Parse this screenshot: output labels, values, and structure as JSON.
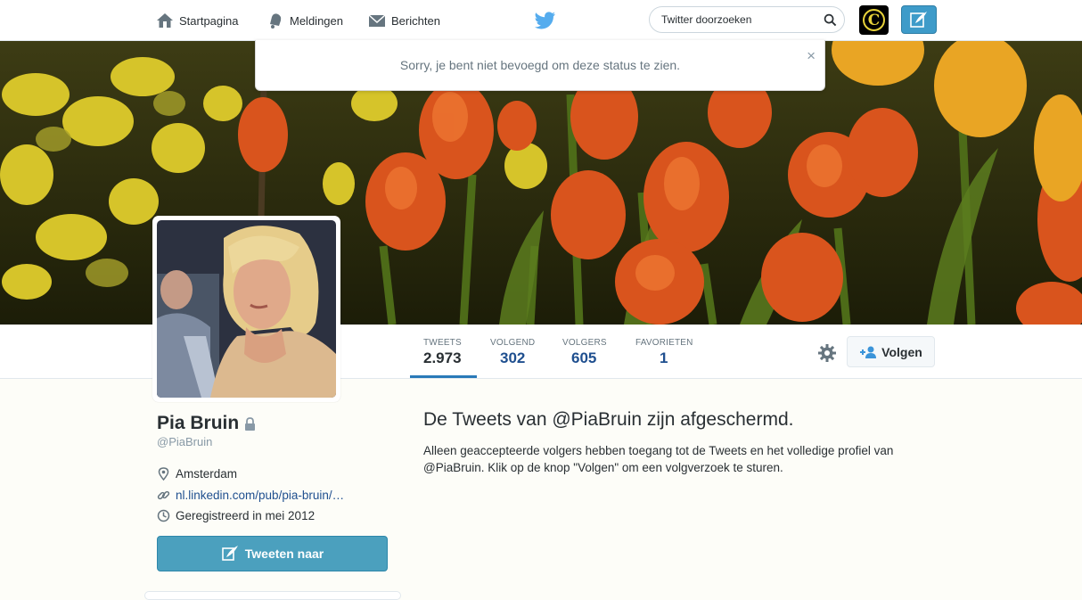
{
  "topbar": {
    "home_label": "Startpagina",
    "notifications_label": "Meldingen",
    "messages_label": "Berichten",
    "search_placeholder": "Twitter doorzoeken",
    "user_avatar_letter": "C"
  },
  "alert": {
    "message": "Sorry, je bent niet bevoegd om deze status te zien.",
    "close_symbol": "×"
  },
  "stats": [
    {
      "label": "TWEETS",
      "value": "2.973"
    },
    {
      "label": "VOLGEND",
      "value": "302"
    },
    {
      "label": "VOLGERS",
      "value": "605"
    },
    {
      "label": "FAVORIETEN",
      "value": "1"
    }
  ],
  "follow_button": "Volgen",
  "profile": {
    "name": "Pia Bruin",
    "handle": "@PiaBruin",
    "location": "Amsterdam",
    "url": "nl.linkedin.com/pub/pia-bruin/…",
    "joined": "Geregistreerd in mei 2012",
    "tweet_to_label": "Tweeten naar"
  },
  "protected": {
    "title": "De Tweets van @PiaBruin zijn afgeschermd.",
    "body": "Alleen geaccepteerde volgers hebben toegang tot de Tweets en het volledige profiel van @PiaBruin. Klik op de knop \"Volgen\" om een volgverzoek te sturen."
  },
  "colors": {
    "accent": "#2a7ab8",
    "stat_value": "#1f4f8f",
    "tweet_button": "#4ba0be",
    "twitter_blue": "#55acee"
  }
}
